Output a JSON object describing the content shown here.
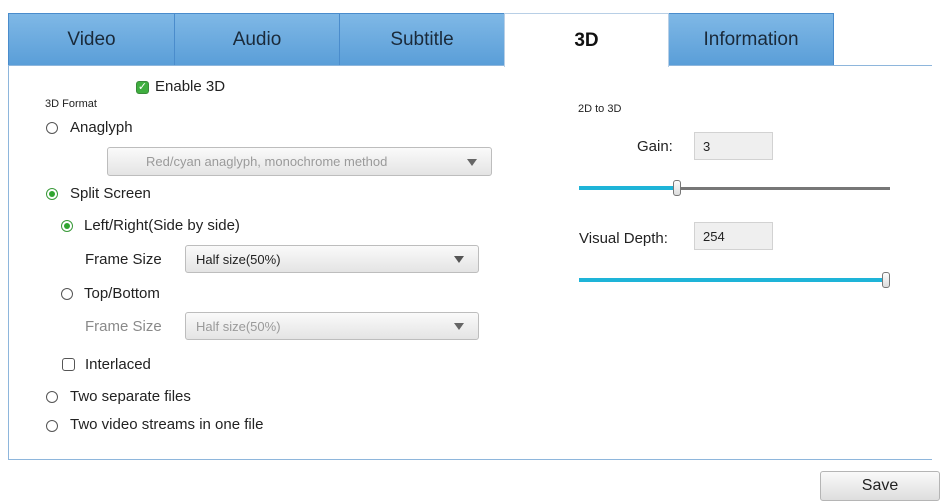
{
  "tabs": [
    {
      "label": "Video"
    },
    {
      "label": "Audio"
    },
    {
      "label": "Subtitle"
    },
    {
      "label": "3D",
      "active": true
    },
    {
      "label": "Information"
    }
  ],
  "enable3d": {
    "label": "Enable 3D",
    "checked": true
  },
  "format": {
    "section_label": "3D Format",
    "anaglyph": {
      "label": "Anaglyph",
      "selected": false,
      "method": "Red/cyan anaglyph, monochrome method"
    },
    "split_screen": {
      "label": "Split Screen",
      "selected": true
    },
    "left_right": {
      "label": "Left/Right(Side by side)",
      "selected": true,
      "frame_size_label": "Frame Size",
      "frame_size_value": "Half size(50%)"
    },
    "top_bottom": {
      "label": "Top/Bottom",
      "selected": false,
      "frame_size_label": "Frame Size",
      "frame_size_value": "Half size(50%)"
    },
    "interlaced": {
      "label": "Interlaced",
      "checked": false
    },
    "two_files": {
      "label": "Two separate files",
      "selected": false
    },
    "two_streams": {
      "label": "Two video streams in one file",
      "selected": false
    }
  },
  "conversion": {
    "section_label": "2D to 3D",
    "gain": {
      "label": "Gain:",
      "value": "3",
      "slider_fraction": 0.31
    },
    "depth": {
      "label": "Visual Depth:",
      "value": "254",
      "slider_fraction": 1.0
    }
  },
  "save_label": "Save",
  "colors": {
    "tab_blue": "#6aaae0",
    "accent_cyan": "#1eb4d8",
    "check_green": "#3fae3f"
  }
}
